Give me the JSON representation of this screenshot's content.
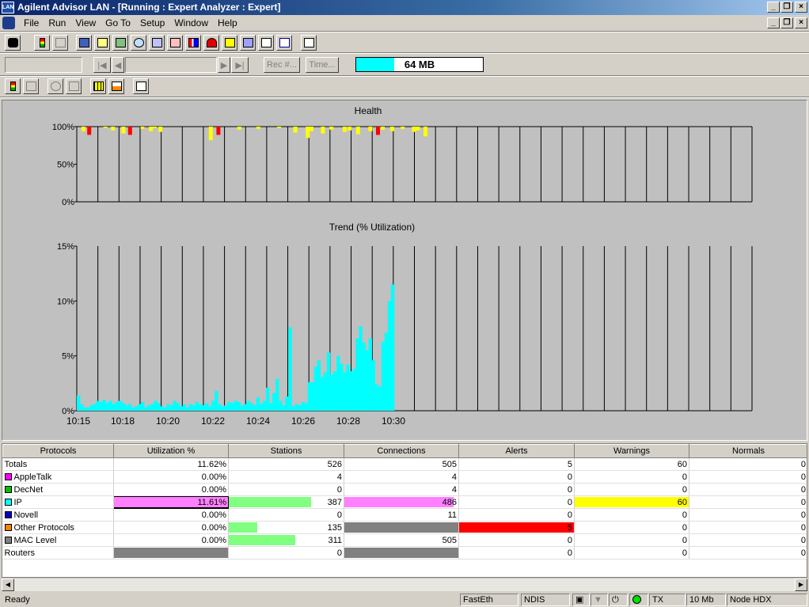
{
  "window": {
    "title": "Agilent Advisor LAN - [Running : Expert Analyzer : Expert]",
    "app_icon_text": "LAN"
  },
  "menu": [
    "File",
    "Run",
    "View",
    "Go To",
    "Setup",
    "Window",
    "Help"
  ],
  "nav": {
    "rec_button": "Rec #...",
    "time_button": "Time...",
    "memory_label": "64 MB",
    "memory_fill_fraction": 0.3
  },
  "colors": {
    "ok_cyan": "#00ffff",
    "warning_yellow": "#ffff00",
    "alert_red": "#ff0000",
    "magenta": "#ff80ff",
    "green": "#80ff80",
    "gray": "#808080"
  },
  "chart_data": [
    {
      "type": "bar",
      "title": "Health",
      "y_ticks": [
        "100%",
        "50%",
        "0%"
      ],
      "ylim": [
        0,
        100
      ],
      "grid": "vertical",
      "note_values_are_dips_from_100": true,
      "series": [
        {
          "color": "#ff0000",
          "x": [
            10.36,
            10.79,
            11.72,
            13.4
          ],
          "values": [
            11,
            11,
            11,
            11
          ]
        },
        {
          "color": "#ffff00",
          "x": [
            10.3,
            10.53,
            10.61,
            10.72,
            10.92,
            11.01,
            11.05,
            11.11,
            11.64,
            11.94,
            12.14,
            12.36,
            12.53,
            12.66,
            12.7,
            12.82,
            12.91,
            13.05,
            13.1,
            13.19,
            13.32,
            13.45,
            13.55,
            13.66,
            13.78,
            13.82,
            13.9
          ],
          "values": [
            6,
            2,
            5,
            9,
            3,
            6,
            2,
            7,
            18,
            4,
            3,
            2,
            8,
            15,
            6,
            9,
            4,
            7,
            5,
            10,
            6,
            4,
            6,
            3,
            7,
            5,
            13
          ]
        }
      ]
    },
    {
      "type": "bar",
      "title": "Trend (% Utilization)",
      "x_ticks": [
        "10:15",
        "10:18",
        "10:20",
        "10:22",
        "10:24",
        "10:26",
        "10:28",
        "10:30"
      ],
      "y_ticks": [
        "15%",
        "10%",
        "5%",
        "0%"
      ],
      "ylim": [
        0,
        15
      ],
      "grid": "vertical",
      "series": [
        {
          "color": "#00ffff",
          "values": [
            1.4,
            0.6,
            0.3,
            0.3,
            0.5,
            0.6,
            0.9,
            0.8,
            1.0,
            0.7,
            0.9,
            0.6,
            0.8,
            0.9,
            0.7,
            0.5,
            0.6,
            0.3,
            0.4,
            0.6,
            0.8,
            0.3,
            0.5,
            0.6,
            0.9,
            0.7,
            0.4,
            0.3,
            0.6,
            0.5,
            0.9,
            0.7,
            0.4,
            0.6,
            0.3,
            0.6,
            0.5,
            0.8,
            0.6,
            0.5,
            0.7,
            0.4,
            0.9,
            1.8,
            0.6,
            0.4,
            0.5,
            0.8,
            0.7,
            0.9,
            0.8,
            0.5,
            0.6,
            0.9,
            0.7,
            0.5,
            1.2,
            0.6,
            0.9,
            2.1,
            0.7,
            1.6,
            2.9,
            0.9,
            0.5,
            1.3,
            7.6,
            0.4,
            0.6,
            0.5,
            0.8,
            0.7,
            2.6,
            2.6,
            4.0,
            4.6,
            3.1,
            3.5,
            5.3,
            3.3,
            3.6,
            5.0,
            4.3,
            3.5,
            4.2,
            3.6,
            3.8,
            6.6,
            7.7,
            6.2,
            5.5,
            6.6,
            4.6,
            2.4,
            2.2,
            6.3,
            7.1,
            10.0,
            11.5
          ]
        }
      ]
    }
  ],
  "table": {
    "columns": [
      "Protocols",
      "Utilization %",
      "Stations",
      "Connections",
      "Alerts",
      "Warnings",
      "Normals"
    ],
    "rows": [
      {
        "name": "Totals",
        "util": "11.62%",
        "stations": "526",
        "connections": "505",
        "alerts": "5",
        "warnings": "60",
        "normals": "0"
      },
      {
        "name": "AppleTalk",
        "swatch": "#ff00ff",
        "util": "0.00%",
        "stations": "4",
        "connections": "4",
        "alerts": "0",
        "warnings": "0",
        "normals": "0"
      },
      {
        "name": "DecNet",
        "swatch": "#00c000",
        "util": "0.00%",
        "stations": "0",
        "connections": "4",
        "alerts": "0",
        "warnings": "0",
        "normals": "0"
      },
      {
        "name": "IP",
        "swatch": "#00ffff",
        "util": "11.61%",
        "stations": "387",
        "connections": "486",
        "alerts": "0",
        "warnings": "60",
        "normals": "0",
        "util_bar": {
          "fraction": 1.0,
          "color": "#ff80ff"
        },
        "stations_bar": {
          "fraction": 0.72,
          "color": "#80ff80"
        },
        "connections_bar": {
          "fraction": 0.96,
          "color": "#ff80ff"
        },
        "warnings_bar": {
          "fraction": 1.0,
          "color": "#ffff00"
        }
      },
      {
        "name": "Novell",
        "swatch": "#0000c0",
        "util": "0.00%",
        "stations": "0",
        "connections": "11",
        "alerts": "0",
        "warnings": "0",
        "normals": "0"
      },
      {
        "name": "Other Protocols",
        "swatch": "#ff8000",
        "util": "0.00%",
        "stations": "135",
        "connections": "",
        "alerts": "5",
        "warnings": "0",
        "normals": "0",
        "stations_bar": {
          "fraction": 0.25,
          "color": "#80ff80"
        },
        "connections_bar": {
          "fraction": 1.0,
          "color": "#808080"
        },
        "alerts_bar": {
          "fraction": 1.0,
          "color": "#ff0000"
        }
      },
      {
        "name": "MAC Level",
        "swatch": "#808080",
        "util": "0.00%",
        "stations": "311",
        "connections": "505",
        "alerts": "0",
        "warnings": "0",
        "normals": "0",
        "stations_bar": {
          "fraction": 0.58,
          "color": "#80ff80"
        }
      },
      {
        "name": "Routers",
        "util": "",
        "stations": "0",
        "connections": "",
        "alerts": "0",
        "warnings": "0",
        "normals": "0",
        "util_bar": {
          "fraction": 1.0,
          "color": "#808080"
        },
        "connections_bar": {
          "fraction": 1.0,
          "color": "#808080"
        }
      }
    ]
  },
  "status": {
    "ready": "Ready",
    "adapter": "FastEth",
    "driver": "NDIS",
    "tx": "TX",
    "speed": "10 Mb",
    "mode": "Node HDX"
  }
}
